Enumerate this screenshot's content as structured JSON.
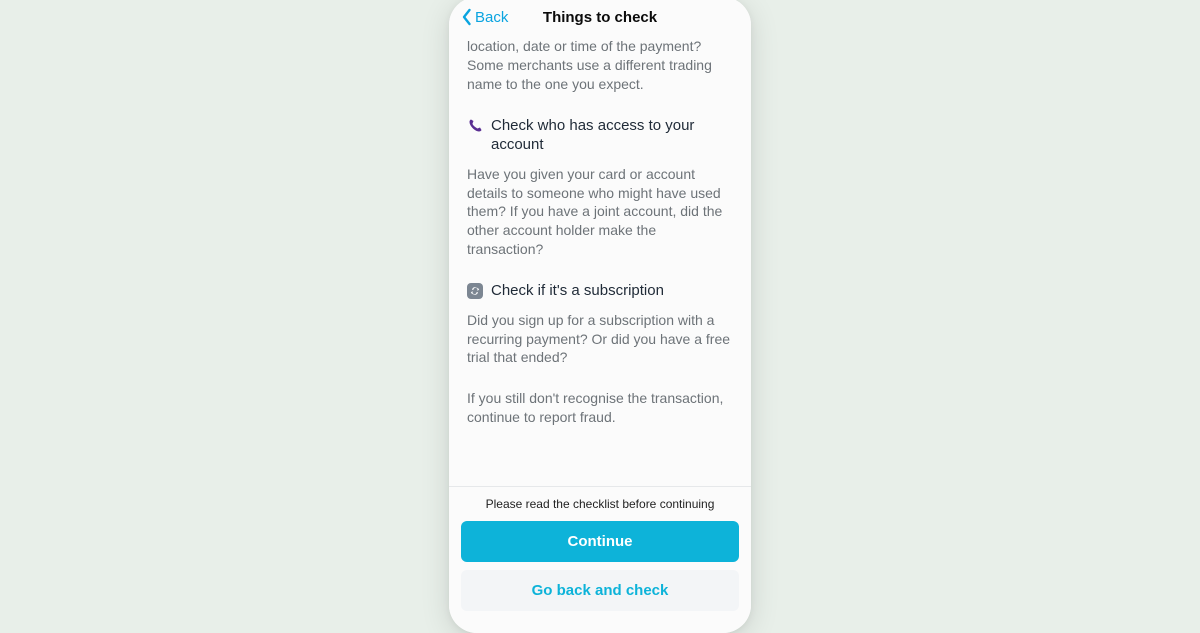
{
  "header": {
    "back_label": "Back",
    "title": "Things to check"
  },
  "intro_fragment": "location, date or time of the payment? Some merchants use a different trading name to the one you expect.",
  "sections": [
    {
      "title": "Check who has access to your account",
      "body": "Have you given your card or account details to someone who might have used them? If you have a joint account, did the other account holder make the transaction?"
    },
    {
      "title": "Check if it's a subscription",
      "body": "Did you sign up for a subscription with a recurring payment? Or did you have a free trial that ended?"
    }
  ],
  "outro": "If you still don't recognise the transaction, continue to report fraud.",
  "footer": {
    "note": "Please read the checklist before continuing",
    "continue_label": "Continue",
    "go_back_label": "Go back and check"
  }
}
